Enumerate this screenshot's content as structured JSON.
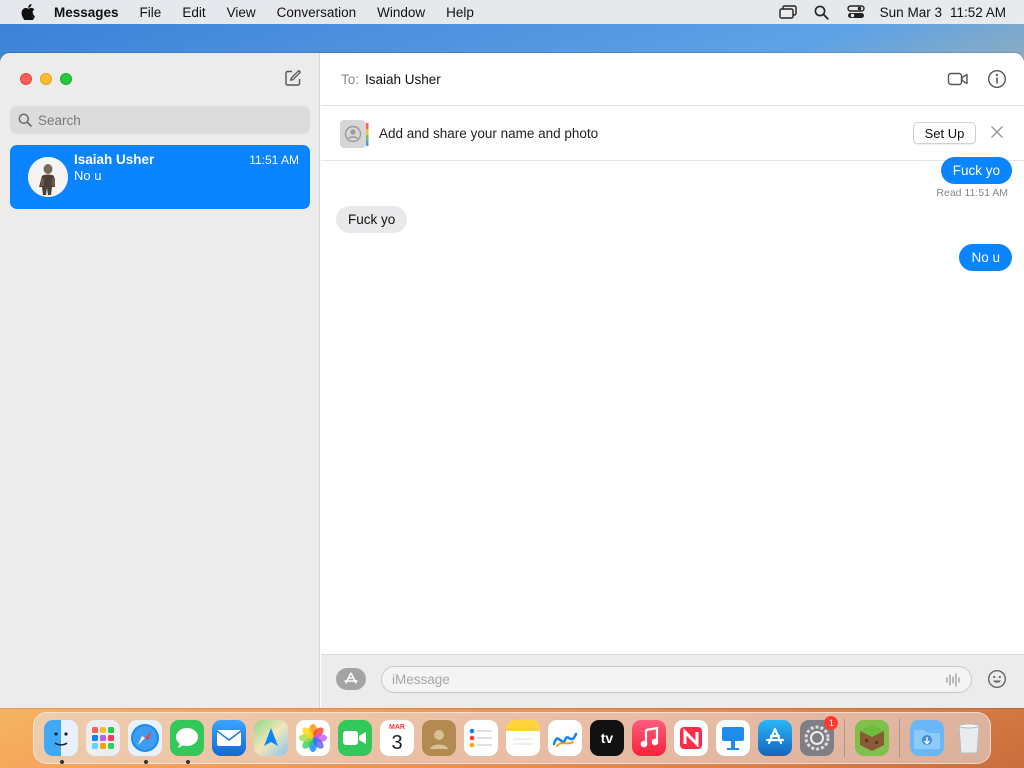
{
  "menubar": {
    "app_name": "Messages",
    "items": [
      "File",
      "Edit",
      "View",
      "Conversation",
      "Window",
      "Help"
    ],
    "date": "Sun Mar 3",
    "time": "11:52 AM",
    "status_icons": [
      "screen-mirroring-icon",
      "spotlight-search-icon",
      "control-center-icon"
    ]
  },
  "sidebar": {
    "search_placeholder": "Search",
    "conversations": [
      {
        "name": "Isaiah Usher",
        "preview": "No u",
        "time": "11:51 AM",
        "selected": true
      }
    ]
  },
  "header": {
    "to_label": "To:",
    "recipient": "Isaiah Usher"
  },
  "banner": {
    "text": "Add and share your name and photo",
    "setup_label": "Set Up"
  },
  "messages": [
    {
      "direction": "out",
      "text": "Fuck yo"
    },
    {
      "direction": "in",
      "text": "Fuck yo"
    },
    {
      "direction": "out",
      "text": "No u"
    }
  ],
  "read_receipt": "Read 11:51 AM",
  "composer": {
    "placeholder": "iMessage"
  },
  "dock": {
    "calendar_month": "MAR",
    "calendar_day": "3",
    "tv_label": "tv",
    "settings_badge": "1",
    "apps": [
      "Finder",
      "Launchpad",
      "Safari",
      "Messages",
      "Mail",
      "Maps",
      "Photos",
      "FaceTime",
      "Calendar",
      "Contacts",
      "Reminders",
      "Notes",
      "Freeform",
      "TV",
      "Music",
      "News",
      "Keynote",
      "App Store",
      "System Settings",
      "Minecraft",
      "Downloads",
      "Trash"
    ]
  },
  "colors": {
    "accent": "#0a84ff",
    "incoming_bubble": "#e9e9eb",
    "sidebar_bg": "#ececec"
  }
}
